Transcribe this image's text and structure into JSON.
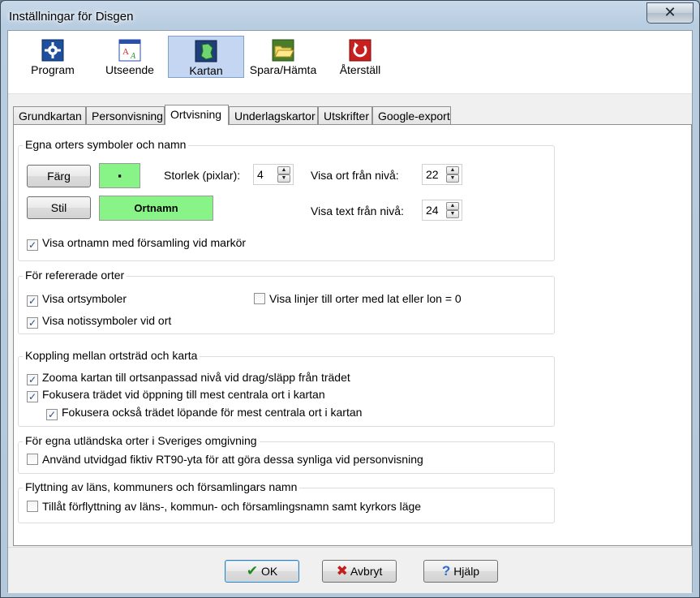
{
  "window": {
    "title": "Inställningar för Disgen",
    "close_glyph": "✕"
  },
  "toolbar": {
    "items": [
      {
        "label": "Program",
        "icon": "gear-icon"
      },
      {
        "label": "Utseende",
        "icon": "font-style-icon"
      },
      {
        "label": "Kartan",
        "icon": "map-icon",
        "active": true
      },
      {
        "label": "Spara/Hämta",
        "icon": "folder-icon"
      },
      {
        "label": "Återställ",
        "icon": "reset-icon"
      }
    ]
  },
  "tabs": {
    "items": [
      "Grundkartan",
      "Personvisning",
      "Ortvisning",
      "Underlagskartor",
      "Utskrifter",
      "Google-export"
    ],
    "active": "Ortvisning"
  },
  "groups": {
    "own": {
      "title": "Egna orters symboler och namn",
      "color_button": "Färg",
      "style_button": "Stil",
      "swatch_symbol": "▪",
      "swatch_text": "Ortnamn",
      "size_label": "Storlek (pixlar):",
      "size_value": "4",
      "show_place_label": "Visa ort från nivå:",
      "show_place_value": "22",
      "show_text_label": "Visa text från nivå:",
      "show_text_value": "24",
      "cb_show_name": {
        "label": "Visa ortnamn med församling vid markör",
        "checked": true
      }
    },
    "referenced": {
      "title": "För refererade orter",
      "cb_symbols": {
        "label": "Visa ortsymboler",
        "checked": true
      },
      "cb_note_symbols": {
        "label": "Visa notissymboler vid ort",
        "checked": true
      },
      "cb_lines": {
        "label": "Visa linjer till orter med lat eller lon = 0",
        "checked": false
      }
    },
    "coupling": {
      "title": "Koppling mellan ortsträd och karta",
      "cb_zoom": {
        "label": "Zooma kartan till ortsanpassad nivå vid drag/släpp från trädet",
        "checked": true
      },
      "cb_focus": {
        "label": "Fokusera trädet vid öppning till mest centrala ort i kartan",
        "checked": true
      },
      "cb_focus_cont": {
        "label": "Fokusera också trädet löpande för mest centrala ort i kartan",
        "checked": true
      }
    },
    "foreign": {
      "title": "För egna utländska orter i Sveriges omgivning",
      "cb_extended": {
        "label": "Använd utvidgad fiktiv RT90-yta för att göra dessa synliga vid personvisning",
        "checked": false
      }
    },
    "move": {
      "title": "Flyttning av läns, kommuners och församlingars namn",
      "cb_allow": {
        "label": "Tillåt förflyttning av  läns-, kommun- och församlingsnamn samt kyrkors läge",
        "checked": false
      }
    }
  },
  "footer": {
    "ok": "OK",
    "cancel": "Avbryt",
    "help": "Hjälp"
  },
  "colors": {
    "accent": "#c5d6f2",
    "swatch": "#88f488",
    "check": "#2c4d7e"
  }
}
